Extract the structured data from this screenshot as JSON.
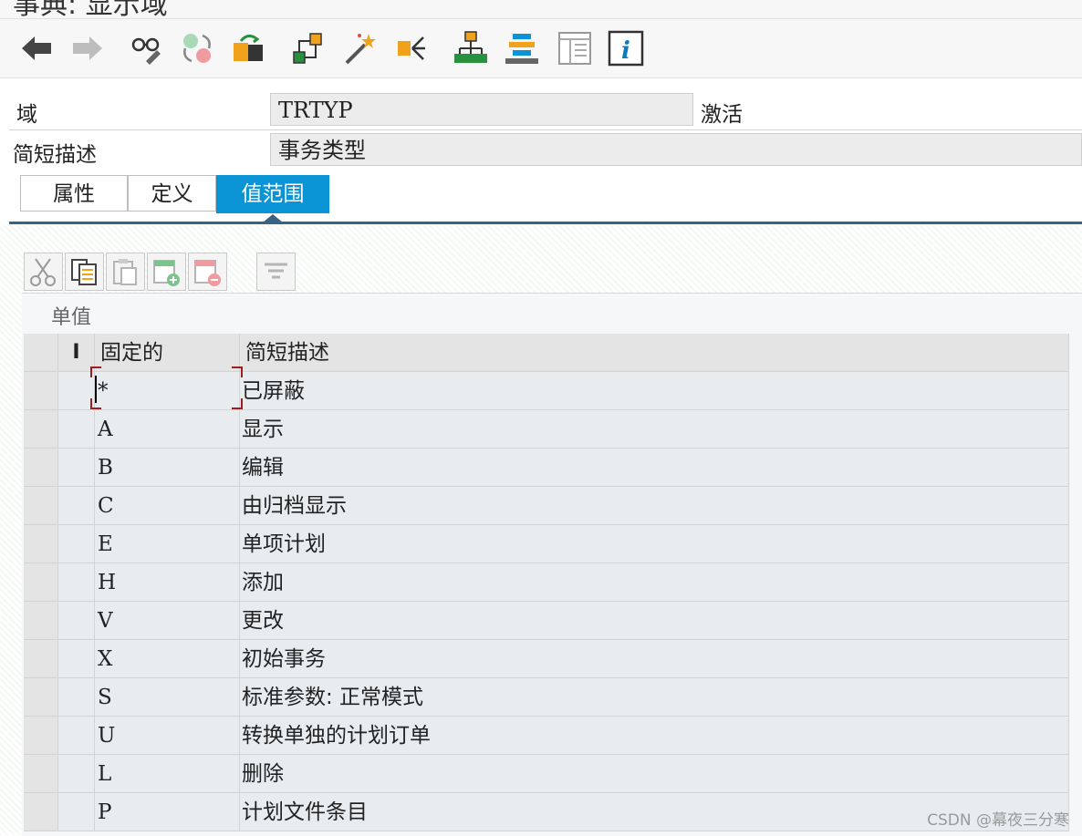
{
  "title": "事典: 显示域",
  "toolbar": {
    "buttons": [
      "back-icon",
      "forward-icon",
      "glasses-edit-icon",
      "toggle-icon",
      "object-list-icon",
      "hierarchy-icon",
      "magic-wand-icon",
      "where-used-icon",
      "org-chart-icon",
      "layout-icon",
      "table-view-icon",
      "info-icon"
    ]
  },
  "header": {
    "domain_label": "域",
    "domain_value": "TRTYP",
    "status": "激活",
    "short_desc_label": "简短描述",
    "short_desc_value": "事务类型"
  },
  "tabs": [
    {
      "label": "属性",
      "active": false
    },
    {
      "label": "定义",
      "active": false
    },
    {
      "label": "值范围",
      "active": true
    }
  ],
  "table_toolbar": {
    "buttons": [
      "cut-icon",
      "copy-icon",
      "paste-icon",
      "insert-row-icon",
      "delete-row-icon",
      "filter-icon"
    ]
  },
  "panel": {
    "title": "单值",
    "columns": {
      "indicator": "I",
      "fixed_value": "固定的",
      "short_desc": "简短描述"
    },
    "rows": [
      {
        "value": "*",
        "desc": "已屏蔽"
      },
      {
        "value": "A",
        "desc": "显示"
      },
      {
        "value": "B",
        "desc": "编辑"
      },
      {
        "value": "C",
        "desc": "由归档显示"
      },
      {
        "value": "E",
        "desc": "单项计划"
      },
      {
        "value": "H",
        "desc": "添加"
      },
      {
        "value": "V",
        "desc": "更改"
      },
      {
        "value": "X",
        "desc": "初始事务"
      },
      {
        "value": "S",
        "desc": "标准参数: 正常模式"
      },
      {
        "value": "U",
        "desc": "转换单独的计划订单"
      },
      {
        "value": "L",
        "desc": "删除"
      },
      {
        "value": "P",
        "desc": "计划文件条目"
      }
    ]
  },
  "watermark": "CSDN @幕夜三分寒",
  "colors": {
    "tab_active": "#0a94d6",
    "underline": "#3a6283",
    "icon_orange": "#f0a21c",
    "icon_green": "#27913f"
  }
}
